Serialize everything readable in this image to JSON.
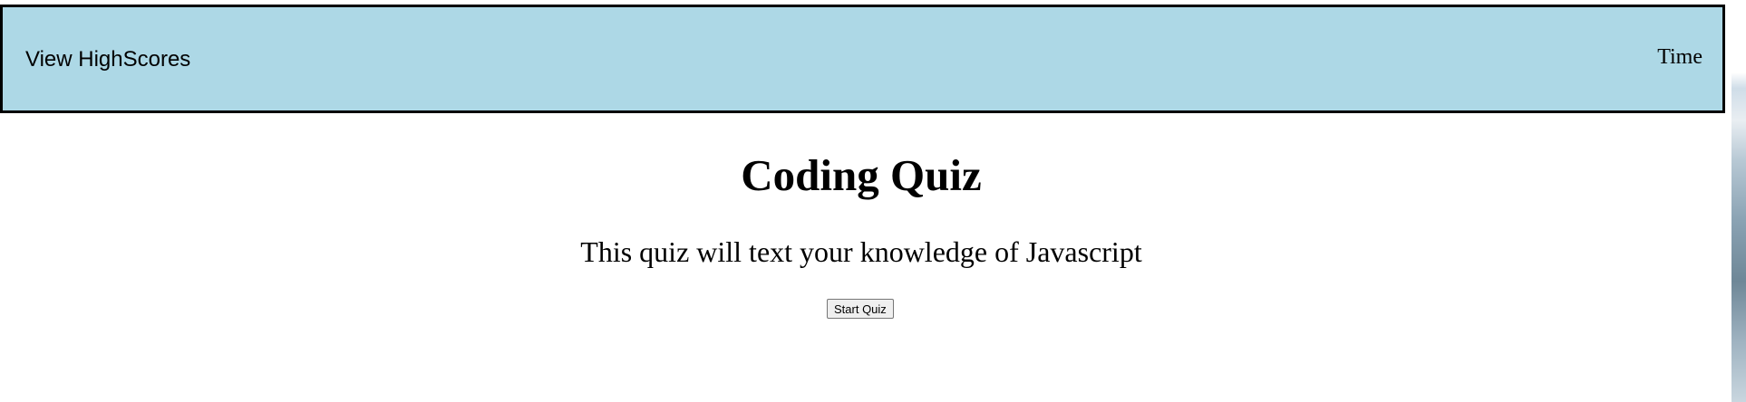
{
  "header": {
    "highscores_label": "View HighScores",
    "time_label": "Time"
  },
  "main": {
    "title": "Coding Quiz",
    "subtitle": "This quiz will text your knowledge of Javascript",
    "start_button_label": "Start Quiz"
  },
  "colors": {
    "header_background": "#add8e6",
    "header_border": "#000000",
    "page_background": "#ffffff"
  }
}
